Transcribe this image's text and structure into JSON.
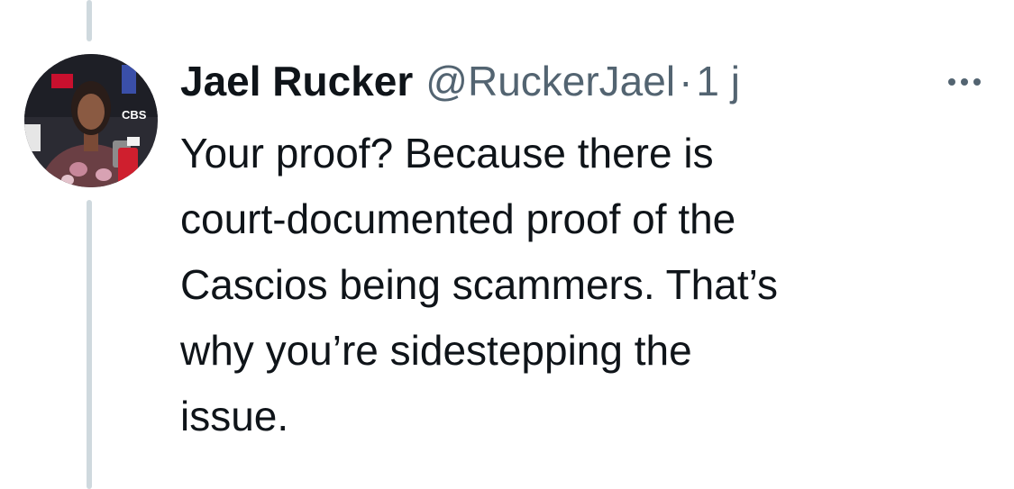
{
  "tweet": {
    "display_name": "Jael Rucker",
    "handle": "@RuckerJael",
    "separator": "·",
    "timestamp": "1 j",
    "text": "Your proof? Because there is\ncourt-documented proof of the\nCascios being scammers. That’s\nwhy you’re sidestepping the\nissue.",
    "more_icon": "more-horizontal-icon",
    "avatar_logo_text": "CBS"
  },
  "colors": {
    "text_primary": "#0f1419",
    "text_secondary": "#536471",
    "thread_line": "#cfd9de",
    "background": "#ffffff"
  }
}
